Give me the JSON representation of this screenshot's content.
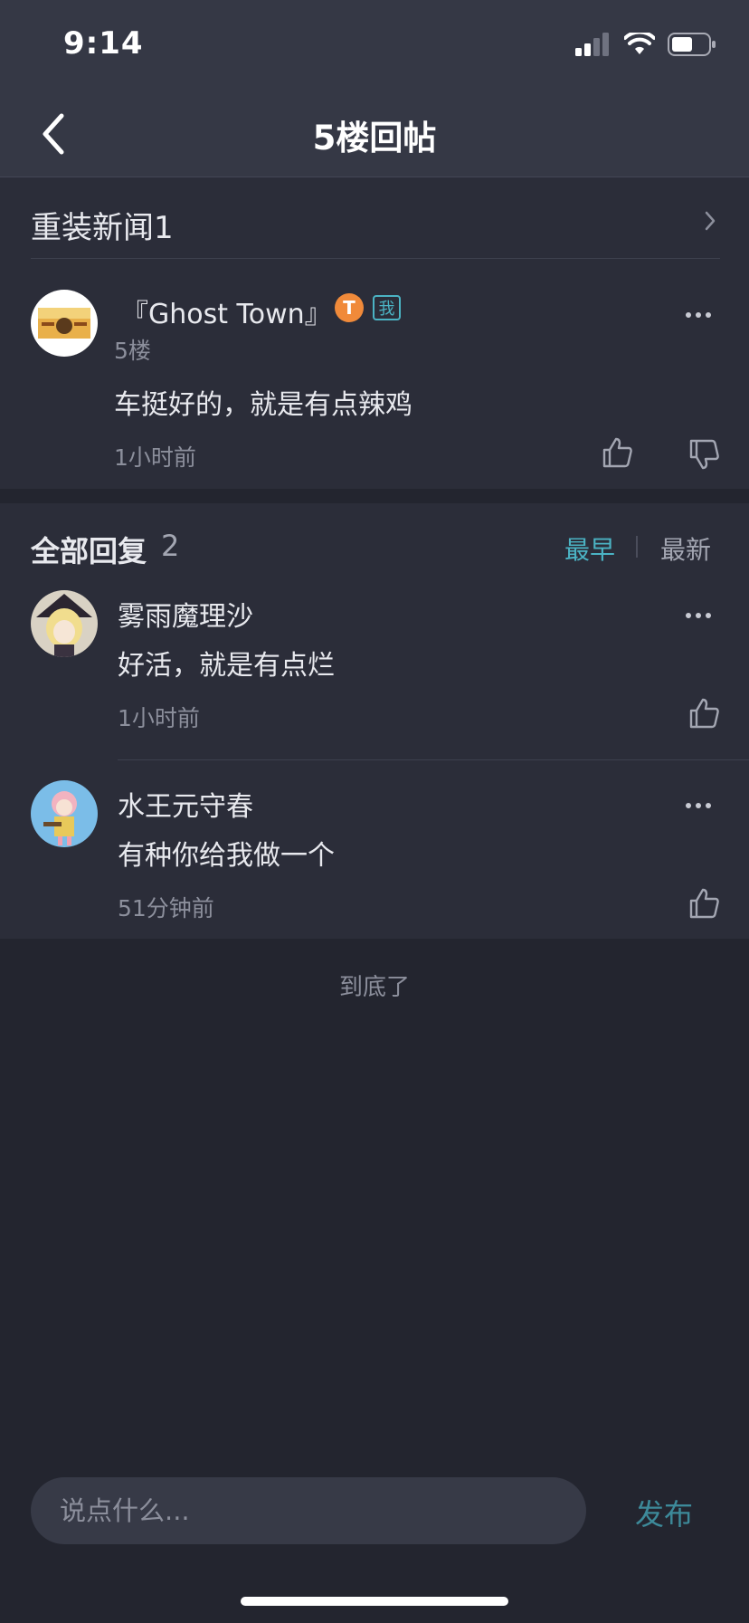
{
  "status_bar": {
    "time": "9:14"
  },
  "header": {
    "title": "5楼回帖"
  },
  "thread": {
    "title": "重装新闻1"
  },
  "post": {
    "author": "『Ghost Town』",
    "level_badge": "T",
    "me_badge": "我",
    "floor": "5楼",
    "content": "车挺好的，就是有点辣鸡",
    "time": "1小时前"
  },
  "replies": {
    "heading": "全部回复",
    "count": "2",
    "sort_earliest": "最早",
    "sort_latest": "最新",
    "items": [
      {
        "name": "雾雨魔理沙",
        "text": "好活，就是有点烂",
        "time": "1小时前"
      },
      {
        "name": "水王元守春",
        "text": "有种你给我做一个",
        "time": "51分钟前"
      }
    ]
  },
  "end_text": "到底了",
  "composer": {
    "placeholder": "说点什么...",
    "publish_label": "发布"
  },
  "colors": {
    "accent": "#4bb3c4",
    "background": "#23252f",
    "card": "#2b2d39",
    "header": "#353845"
  }
}
